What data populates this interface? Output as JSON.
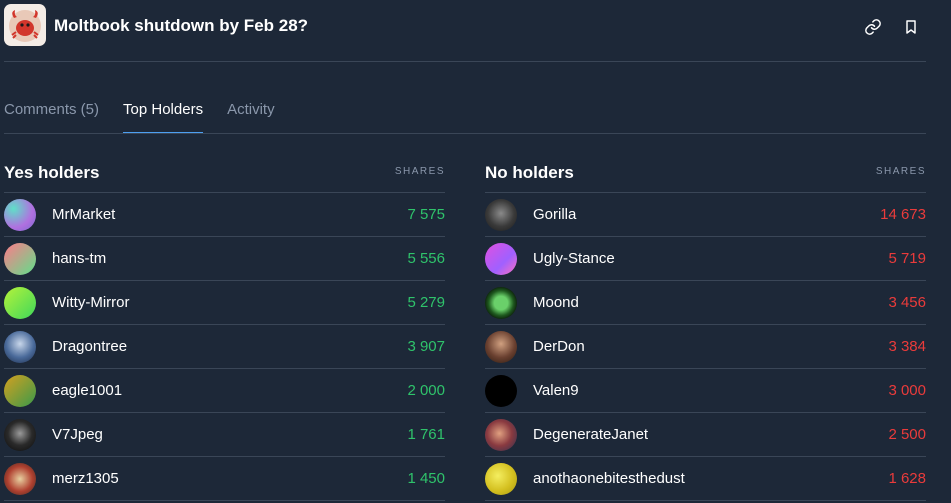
{
  "market": {
    "title": "Moltbook shutdown by Feb 28?",
    "icon": "crab-logo-icon"
  },
  "header_actions": [
    {
      "name": "link-icon"
    },
    {
      "name": "bookmark-icon"
    }
  ],
  "tabs": [
    {
      "label": "Comments (5)",
      "active": false
    },
    {
      "label": "Top Holders",
      "active": true
    },
    {
      "label": "Activity",
      "active": false
    }
  ],
  "yes_holders": {
    "title": "Yes holders",
    "column": "SHARES",
    "color": "#2fc36b",
    "rows": [
      {
        "name": "MrMarket",
        "shares": "7 575"
      },
      {
        "name": "hans-tm",
        "shares": "5 556"
      },
      {
        "name": "Witty-Mirror",
        "shares": "5 279"
      },
      {
        "name": "Dragontree",
        "shares": "3 907"
      },
      {
        "name": "eagle1001",
        "shares": "2 000"
      },
      {
        "name": "V7Jpeg",
        "shares": "1 761"
      },
      {
        "name": "merz1305",
        "shares": "1 450"
      }
    ]
  },
  "no_holders": {
    "title": "No holders",
    "column": "SHARES",
    "color": "#ea3b3b",
    "rows": [
      {
        "name": "Gorilla",
        "shares": "14 673"
      },
      {
        "name": "Ugly-Stance",
        "shares": "5 719"
      },
      {
        "name": "Moond",
        "shares": "3 456"
      },
      {
        "name": "DerDon",
        "shares": "3 384"
      },
      {
        "name": "Valen9",
        "shares": "3 000"
      },
      {
        "name": "DegenerateJanet",
        "shares": "2 500"
      },
      {
        "name": "anothaonebitesthedust",
        "shares": "1 628"
      }
    ]
  }
}
